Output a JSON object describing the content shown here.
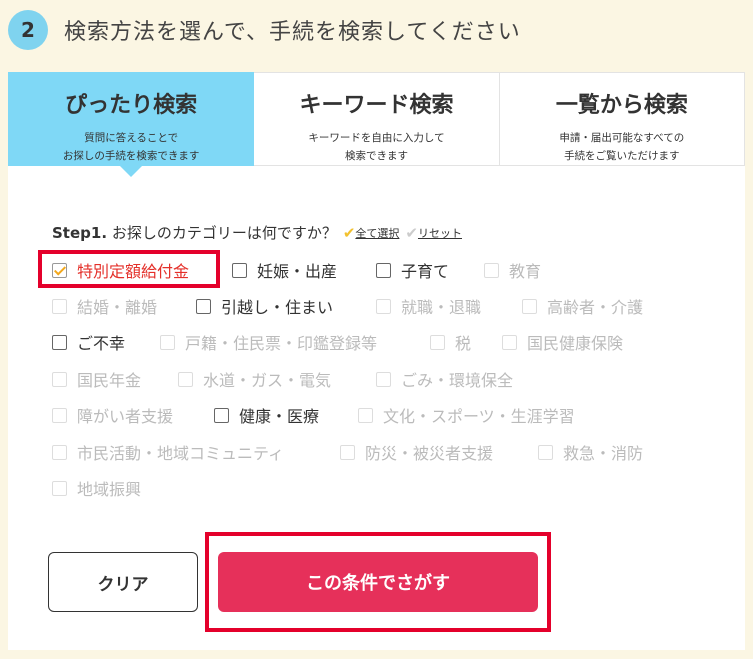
{
  "header": {
    "step_number": "2",
    "title": "検索方法を選んで、手続を検索してください"
  },
  "tabs": [
    {
      "title": "ぴったり検索",
      "desc": "質問に答えることで\nお探しの手続を検索できます"
    },
    {
      "title": "キーワード検索",
      "desc": "キーワードを自由に入力して\n検索できます"
    },
    {
      "title": "一覧から検索",
      "desc": "申請・届出可能なすべての\n手続をご覧いただけます"
    }
  ],
  "step1": {
    "prefix": "Step1.",
    "question": "お探しのカテゴリーは何ですか？",
    "select_all": "全て選択",
    "reset": "リセット"
  },
  "categories": [
    {
      "label": "特別定額給付金",
      "state": "checked"
    },
    {
      "label": "妊娠・出産",
      "state": "enabled"
    },
    {
      "label": "子育て",
      "state": "enabled"
    },
    {
      "label": "教育",
      "state": "disabled"
    },
    {
      "label": "結婚・離婚",
      "state": "disabled"
    },
    {
      "label": "引越し・住まい",
      "state": "enabled"
    },
    {
      "label": "就職・退職",
      "state": "disabled"
    },
    {
      "label": "高齢者・介護",
      "state": "disabled"
    },
    {
      "label": "ご不幸",
      "state": "enabled"
    },
    {
      "label": "戸籍・住民票・印鑑登録等",
      "state": "disabled"
    },
    {
      "label": "税",
      "state": "disabled"
    },
    {
      "label": "国民健康保険",
      "state": "disabled"
    },
    {
      "label": "国民年金",
      "state": "disabled"
    },
    {
      "label": "水道・ガス・電気",
      "state": "disabled"
    },
    {
      "label": "ごみ・環境保全",
      "state": "disabled"
    },
    {
      "label": "障がい者支援",
      "state": "disabled"
    },
    {
      "label": "健康・医療",
      "state": "enabled"
    },
    {
      "label": "文化・スポーツ・生涯学習",
      "state": "disabled"
    },
    {
      "label": "市民活動・地域コミュニティ",
      "state": "disabled"
    },
    {
      "label": "防災・被災者支援",
      "state": "disabled"
    },
    {
      "label": "救急・消防",
      "state": "disabled"
    },
    {
      "label": "地域振興",
      "state": "disabled"
    }
  ],
  "buttons": {
    "clear": "クリア",
    "search": "この条件でさがす"
  },
  "colors": {
    "accent_blue": "#7fd8f6",
    "search_red": "#e6305a",
    "highlight_red": "#e4002b",
    "check_yellow": "#f2c12e"
  }
}
